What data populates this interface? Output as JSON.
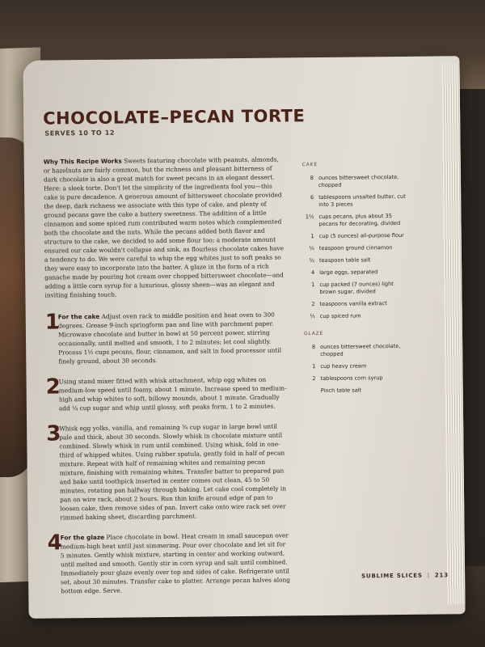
{
  "recipe": {
    "title": "CHOCOLATE–PECAN TORTE",
    "serves": "SERVES 10 TO 12",
    "intro_lead": "Why This Recipe Works",
    "intro_text": " Sweets featuring chocolate with peanuts, almonds, or hazelnuts are fairly common, but the richness and pleasant bitterness of dark chocolate is also a great match for sweet pecans in an elegant dessert. Here: a sleek torte. Don't let the simplicity of the ingredients fool you—this cake is pure decadence. A generous amount of bittersweet chocolate provided the deep, dark richness we associate with this type of cake, and plenty of ground pecans gave the cake a buttery sweetness. The addition of a little cinnamon and some spiced rum contributed warm notes which complemented both the chocolate and the nuts. While the pecans added both flavor and structure to the cake, we decided to add some flour too; a moderate amount ensured our cake wouldn't collapse and sink, as flourless chocolate cakes have a tendency to do. We were careful to whip the egg whites just to soft peaks so they were easy to incorporate into the batter. A glaze in the form of a rich ganache made by pouring hot cream over chopped bittersweet chocolate—and adding a little corn syrup for a luxurious, glossy sheen—was an elegant and inviting finishing touch.",
    "steps": [
      {
        "num": "1",
        "head": "For the cake",
        "text": " Adjust oven rack to middle position and heat oven to 300 degrees. Grease 9-inch springform pan and line with parchment paper. Microwave chocolate and butter in bowl at 50 percent power, stirring occasionally, until melted and smooth, 1 to 2 minutes; let cool slightly. Process 1½ cups pecans, flour, cinnamon, and salt in food processor until finely ground, about 30 seconds."
      },
      {
        "num": "2",
        "head": "",
        "text": "Using stand mixer fitted with whisk attachment, whip egg whites on medium-low speed until foamy, about 1 minute. Increase speed to medium-high and whip whites to soft, billowy mounds, about 1 minute. Gradually add ¼ cup sugar and whip until glossy, soft peaks form, 1 to 2 minutes."
      },
      {
        "num": "3",
        "head": "",
        "text": "Whisk egg yolks, vanilla, and remaining ¾ cup sugar in large bowl until pale and thick, about 30 seconds. Slowly whisk in chocolate mixture until combined. Slowly whisk in rum until combined. Using whisk, fold in one-third of whipped whites. Using rubber spatula, gently fold in half of pecan mixture. Repeat with half of remaining whites and remaining pecan mixture, finishing with remaining whites. Transfer batter to prepared pan and bake until toothpick inserted in center comes out clean, 45 to 50 minutes, rotating pan halfway through baking. Let cake cool completely in pan on wire rack, about 2 hours. Run thin knife around edge of pan to loosen cake, then remove sides of pan. Invert cake onto wire rack set over rimmed baking sheet, discarding parchment."
      },
      {
        "num": "4",
        "head": "For the glaze",
        "text": " Place chocolate in bowl. Heat cream in small saucepan over medium-high heat until just simmering. Pour over chocolate and let sit for 5 minutes. Gently whisk mixture, starting in center and working outward, until melted and smooth. Gently stir in corn syrup and salt until combined. Immediately pour glaze evenly over top and sides of cake. Refrigerate until set, about 30 minutes. Transfer cake to platter. Arrange pecan halves along bottom edge. Serve."
      }
    ],
    "ingredient_groups": [
      {
        "heading": "CAKE",
        "items": [
          {
            "qty": "8",
            "text": "ounces bittersweet chocolate, chopped"
          },
          {
            "qty": "6",
            "text": "tablespoons unsalted butter, cut into 3 pieces"
          },
          {
            "qty": "1½",
            "text": "cups pecans, plus about 35 pecans for decorating, divided"
          },
          {
            "qty": "1",
            "text": "cup (5 ounces) all-purpose flour"
          },
          {
            "qty": "⅛",
            "text": "teaspoon ground cinnamon"
          },
          {
            "qty": "½",
            "text": "teaspoon table salt"
          },
          {
            "qty": "4",
            "text": "large eggs, separated"
          },
          {
            "qty": "1",
            "text": "cup packed (7 ounces) light brown sugar, divided"
          },
          {
            "qty": "2",
            "text": "teaspoons vanilla extract"
          },
          {
            "qty": "⅓",
            "text": "cup spiced rum"
          }
        ]
      },
      {
        "heading": "GLAZE",
        "items": [
          {
            "qty": "8",
            "text": "ounces bittersweet chocolate, chopped"
          },
          {
            "qty": "1",
            "text": "cup heavy cream"
          },
          {
            "qty": "2",
            "text": "tablespoons corn syrup"
          },
          {
            "qty": "",
            "text": "Pinch table salt"
          }
        ]
      }
    ]
  },
  "footer": {
    "section": "SUBLIME SLICES",
    "separator": "|",
    "page_number": "213"
  },
  "colors": {
    "title": "#4a2318",
    "paper": "#e3ded6",
    "background": "#2a2420"
  }
}
